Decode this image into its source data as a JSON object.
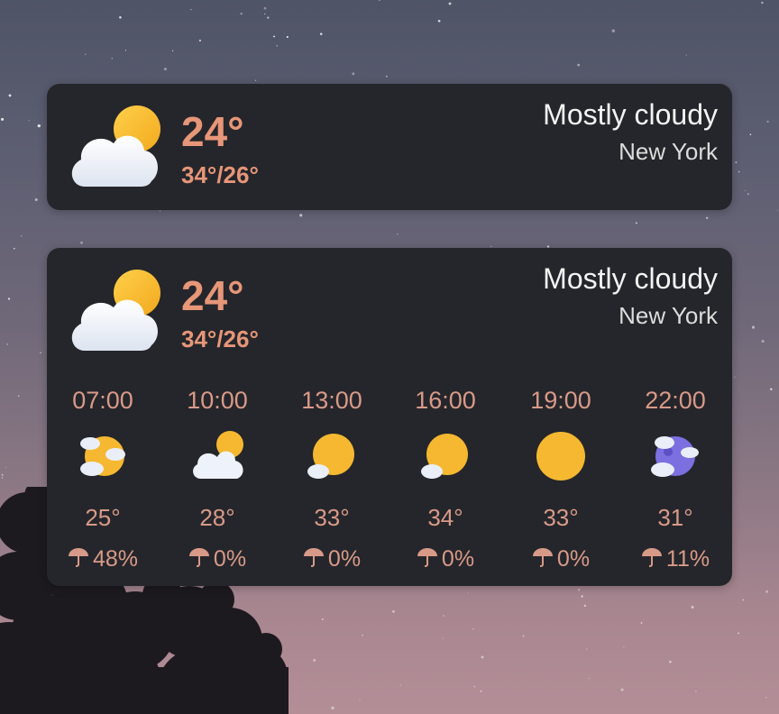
{
  "widgets": [
    {
      "temp": "24°",
      "hilo": "34°/26°",
      "condition": "Mostly cloudy",
      "city": "New York",
      "icon": "mostly-cloudy-icon"
    },
    {
      "temp": "24°",
      "hilo": "34°/26°",
      "condition": "Mostly cloudy",
      "city": "New York",
      "icon": "mostly-cloudy-icon",
      "hourly": [
        {
          "time": "07:00",
          "temp": "25°",
          "precip": "48%",
          "icon": "sun-clouds-icon"
        },
        {
          "time": "10:00",
          "temp": "28°",
          "precip": "0%",
          "icon": "mostly-cloudy-icon"
        },
        {
          "time": "13:00",
          "temp": "33°",
          "precip": "0%",
          "icon": "partly-sunny-icon"
        },
        {
          "time": "16:00",
          "temp": "34°",
          "precip": "0%",
          "icon": "partly-sunny-icon"
        },
        {
          "time": "19:00",
          "temp": "33°",
          "precip": "0%",
          "icon": "sunny-icon"
        },
        {
          "time": "22:00",
          "temp": "31°",
          "precip": "11%",
          "icon": "moon-clouds-icon"
        }
      ]
    }
  ],
  "colors": {
    "accent": "#e79678",
    "secondary_text": "#d89a88",
    "card": "#25262b",
    "sun": "#f5b830",
    "moon": "#7c6fe0"
  }
}
